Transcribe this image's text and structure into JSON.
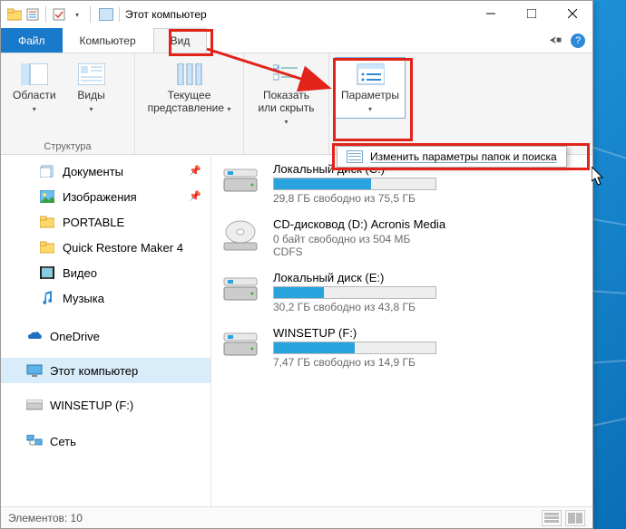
{
  "titlebar": {
    "title": "Этот компьютер"
  },
  "tabs": {
    "file": "Файл",
    "computer": "Компьютер",
    "view": "Вид"
  },
  "ribbon": {
    "panes": {
      "label": "Области",
      "group": "Структура"
    },
    "views": {
      "label": "Виды"
    },
    "current_view": {
      "line1": "Текущее",
      "line2": "представление"
    },
    "show_hide": {
      "line1": "Показать",
      "line2": "или скрыть"
    },
    "options": {
      "label": "Параметры"
    }
  },
  "dropdown": {
    "label": "Изменить параметры папок и поиска"
  },
  "nav": {
    "documents": "Документы",
    "pictures": "Изображения",
    "portable": "PORTABLE",
    "qrm": "Quick Restore Maker 4",
    "videos": "Видео",
    "music": "Музыка",
    "onedrive": "OneDrive",
    "this_pc": "Этот компьютер",
    "winsetup": "WINSETUP (F:)",
    "network": "Сеть"
  },
  "drives": [
    {
      "name": "Локальный диск (C:)",
      "info": "29,8 ГБ свободно из 75,5 ГБ",
      "fill": 60,
      "type": "hdd"
    },
    {
      "name": "CD-дисковод (D:) Acronis Media",
      "info": "0 байт свободно из 504 МБ",
      "info2": "CDFS",
      "type": "cd"
    },
    {
      "name": "Локальный диск (E:)",
      "info": "30,2 ГБ свободно из 43,8 ГБ",
      "fill": 31,
      "type": "hdd"
    },
    {
      "name": "WINSETUP (F:)",
      "info": "7,47 ГБ свободно из 14,9 ГБ",
      "fill": 50,
      "type": "hdd"
    }
  ],
  "status": {
    "left_label": "Элементов:",
    "count": "10"
  }
}
